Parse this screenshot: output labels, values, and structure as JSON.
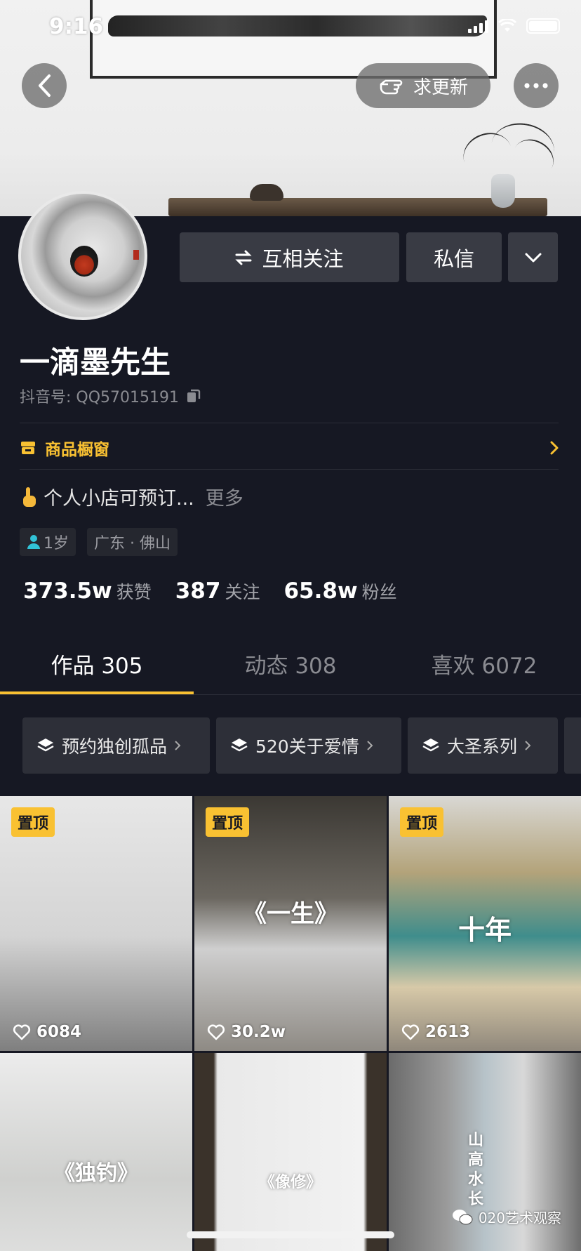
{
  "status_bar": {
    "time": "9:16"
  },
  "header": {
    "request_update_label": "求更新"
  },
  "profile": {
    "follow_button_label": "互相关注",
    "message_button_label": "私信",
    "name": "一滴墨先生",
    "douyin_id": "抖音号: QQ57015191",
    "shop_label": "商品橱窗",
    "bio": "个人小店可预订...",
    "bio_more": "更多",
    "age_tag": "1岁",
    "location_tag": "广东 · 佛山",
    "stats": [
      {
        "value": "373.5w",
        "label": "获赞"
      },
      {
        "value": "387",
        "label": "关注"
      },
      {
        "value": "65.8w",
        "label": "粉丝"
      }
    ]
  },
  "tabs": [
    {
      "label": "作品 305",
      "active": true
    },
    {
      "label": "动态 308",
      "active": false
    },
    {
      "label": "喜欢 6072",
      "active": false
    }
  ],
  "collections": [
    "预约独创孤品",
    "520关于爱情",
    "大圣系列"
  ],
  "videos": [
    {
      "pinned_label": "置顶",
      "likes": "6084",
      "title": ""
    },
    {
      "pinned_label": "置顶",
      "likes": "30.2w",
      "title": "《一生》"
    },
    {
      "pinned_label": "置顶",
      "likes": "2613",
      "title": "十年"
    },
    {
      "pinned_label": "",
      "likes": "",
      "title": "《独钓》"
    },
    {
      "pinned_label": "",
      "likes": "",
      "title": "《像修》"
    },
    {
      "pinned_label": "",
      "likes": "",
      "title": "山高水长"
    }
  ],
  "watermark": "020艺术观察",
  "colors": {
    "background": "#161823",
    "accent": "#f9c132",
    "button": "#393b44"
  }
}
